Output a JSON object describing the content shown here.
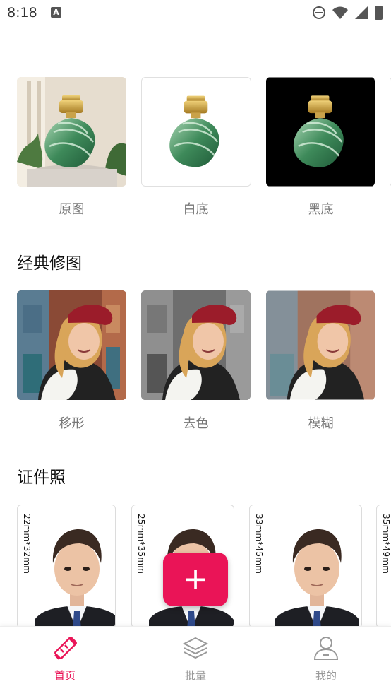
{
  "status_bar": {
    "time": "8:18",
    "icons": [
      "notification-a-icon",
      "dnd-icon",
      "wifi-icon",
      "signal-icon",
      "battery-icon"
    ]
  },
  "background_options": [
    {
      "label": "原图",
      "bg": "#e8e0d4"
    },
    {
      "label": "白底",
      "bg": "#ffffff"
    },
    {
      "label": "黑底",
      "bg": "#000000"
    }
  ],
  "classic": {
    "title": "经典修图",
    "items": [
      {
        "label": "移形"
      },
      {
        "label": "去色"
      },
      {
        "label": "模糊"
      }
    ]
  },
  "id_photo": {
    "title": "证件照",
    "sizes": [
      "22mm*32mm",
      "25mm*35mm",
      "33mm*45mm",
      "35mm*49mm"
    ]
  },
  "fab": {
    "symbol": "+"
  },
  "bottom_nav": {
    "items": [
      {
        "label": "首页",
        "active": true
      },
      {
        "label": "批量",
        "active": false
      },
      {
        "label": "我的",
        "active": false
      }
    ],
    "active_color": "#ea1457",
    "inactive_color": "#999999"
  }
}
